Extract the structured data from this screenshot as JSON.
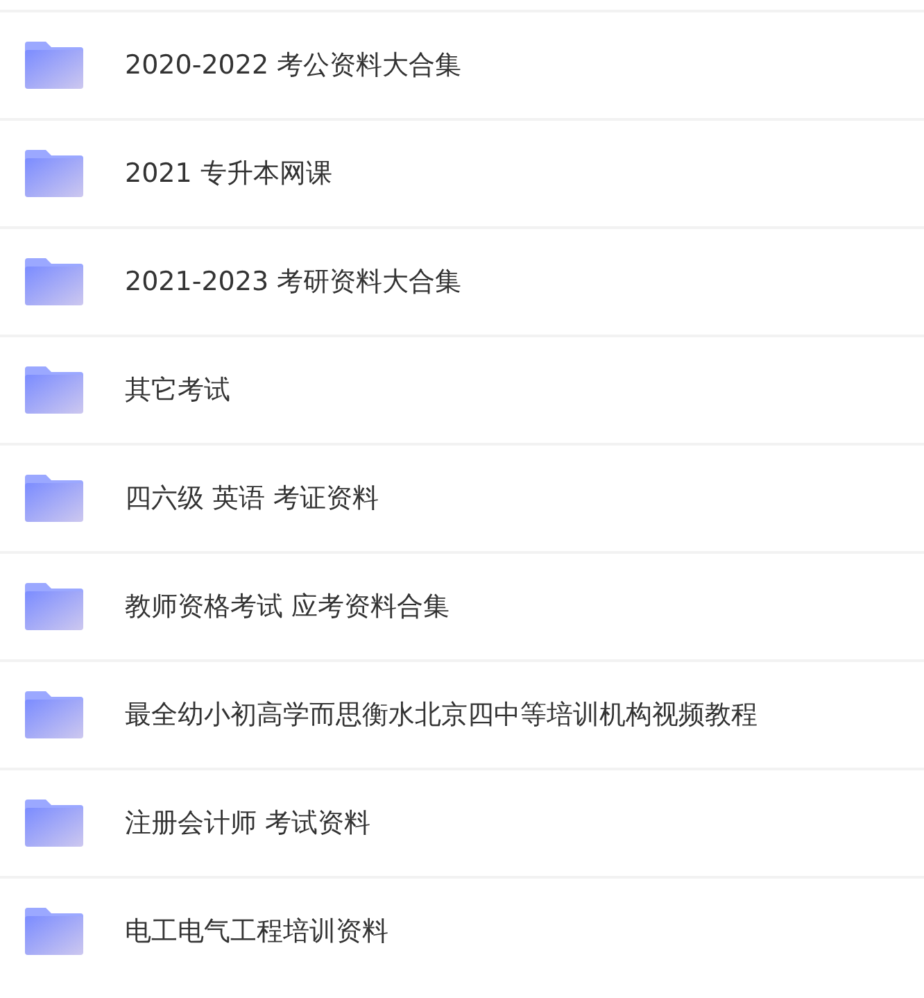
{
  "folders": [
    {
      "name": "2020-2022 考公资料大合集"
    },
    {
      "name": "2021 专升本网课"
    },
    {
      "name": "2021-2023 考研资料大合集"
    },
    {
      "name": "其它考试"
    },
    {
      "name": "四六级 英语 考证资料"
    },
    {
      "name": "教师资格考试 应考资料合集"
    },
    {
      "name": "最全幼小初高学而思衡水北京四中等培训机构视频教程"
    },
    {
      "name": "注册会计师 考试资料"
    },
    {
      "name": "电工电气工程培训资料"
    }
  ]
}
